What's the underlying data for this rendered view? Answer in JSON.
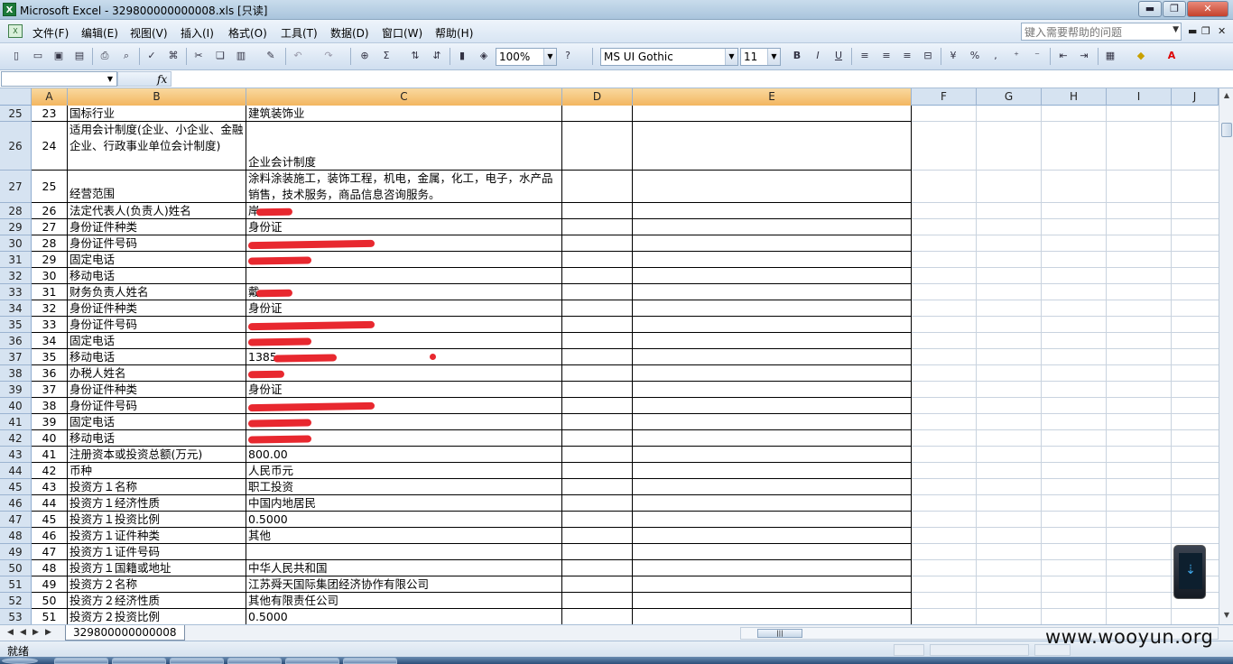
{
  "window": {
    "title": "Microsoft Excel - 329800000000008.xls  [只读]",
    "minimize_glyph": "▬",
    "restore_glyph": "❐",
    "close_glyph": "✕"
  },
  "menu": [
    "文件(F)",
    "编辑(E)",
    "视图(V)",
    "插入(I)",
    "格式(O)",
    "工具(T)",
    "数据(D)",
    "窗口(W)",
    "帮助(H)"
  ],
  "menu_right": {
    "help_placeholder": "键入需要帮助的问题"
  },
  "toolbar": {
    "zoom": "100%",
    "font_name": "MS UI Gothic",
    "font_size": "11"
  },
  "formula": {
    "fx_label": "fx"
  },
  "columns": [
    "A",
    "B",
    "C",
    "D",
    "E",
    "F",
    "G",
    "H",
    "I",
    "J"
  ],
  "selected_columns": [
    "A",
    "B",
    "C",
    "D",
    "E"
  ],
  "rows": [
    {
      "n": "25",
      "a": "23",
      "b": "国标行业",
      "c": "建筑装饰业"
    },
    {
      "n": "26",
      "a": "24",
      "b": "适用会计制度(企业、小企业、金融企业、行政事业单位会计制度)",
      "c": "企业会计制度",
      "tall": true
    },
    {
      "n": "27",
      "a": "25",
      "b": "经营范围",
      "c": "涂料涂装施工，装饰工程，机电，金属，化工，电子，水产品销售，技术服务，商品信息咨询服务。",
      "tall2": true
    },
    {
      "n": "28",
      "a": "26",
      "b": "法定代表人(负责人)姓名",
      "c": "岸",
      "redact": 1
    },
    {
      "n": "29",
      "a": "27",
      "b": "身份证件种类",
      "c": "身份证"
    },
    {
      "n": "30",
      "a": "28",
      "b": "身份证件号码",
      "c": "",
      "redact": 2
    },
    {
      "n": "31",
      "a": "29",
      "b": "固定电话",
      "c": "",
      "redact": 3
    },
    {
      "n": "32",
      "a": "30",
      "b": "移动电话",
      "c": ""
    },
    {
      "n": "33",
      "a": "31",
      "b": "财务负责人姓名",
      "c": "戴",
      "redact": 1
    },
    {
      "n": "34",
      "a": "32",
      "b": "身份证件种类",
      "c": "身份证"
    },
    {
      "n": "35",
      "a": "33",
      "b": "身份证件号码",
      "c": "",
      "redact": 2
    },
    {
      "n": "36",
      "a": "34",
      "b": "固定电话",
      "c": "",
      "redact": 3
    },
    {
      "n": "37",
      "a": "35",
      "b": "移动电话",
      "c": "1385",
      "redact": 3
    },
    {
      "n": "38",
      "a": "36",
      "b": "办税人姓名",
      "c": "",
      "redact": 1
    },
    {
      "n": "39",
      "a": "37",
      "b": "身份证件种类",
      "c": "身份证"
    },
    {
      "n": "40",
      "a": "38",
      "b": "身份证件号码",
      "c": "",
      "redact": 2
    },
    {
      "n": "41",
      "a": "39",
      "b": "固定电话",
      "c": "",
      "redact": 3
    },
    {
      "n": "42",
      "a": "40",
      "b": "移动电话",
      "c": "",
      "redact": 3
    },
    {
      "n": "43",
      "a": "41",
      "b": "注册资本或投资总额(万元)",
      "c": "800.00"
    },
    {
      "n": "44",
      "a": "42",
      "b": "币种",
      "c": "人民币元"
    },
    {
      "n": "45",
      "a": "43",
      "b": "投资方１名称",
      "c": "职工投资"
    },
    {
      "n": "46",
      "a": "44",
      "b": "投资方１经济性质",
      "c": "中国内地居民"
    },
    {
      "n": "47",
      "a": "45",
      "b": "投资方１投资比例",
      "c": "0.5000"
    },
    {
      "n": "48",
      "a": "46",
      "b": "投资方１证件种类",
      "c": "其他"
    },
    {
      "n": "49",
      "a": "47",
      "b": "投资方１证件号码",
      "c": ""
    },
    {
      "n": "50",
      "a": "48",
      "b": "投资方１国籍或地址",
      "c": "中华人民共和国"
    },
    {
      "n": "51",
      "a": "49",
      "b": "投资方２名称",
      "c": "江苏舜天国际集团经济协作有限公司"
    },
    {
      "n": "52",
      "a": "50",
      "b": "投资方２经济性质",
      "c": "其他有限责任公司"
    },
    {
      "n": "53",
      "a": "51",
      "b": "投资方２投资比例",
      "c": "0.5000"
    }
  ],
  "sheet": {
    "tab_name": "329800000000008"
  },
  "status": {
    "text": "就绪"
  },
  "watermark": "www.wooyun.org"
}
